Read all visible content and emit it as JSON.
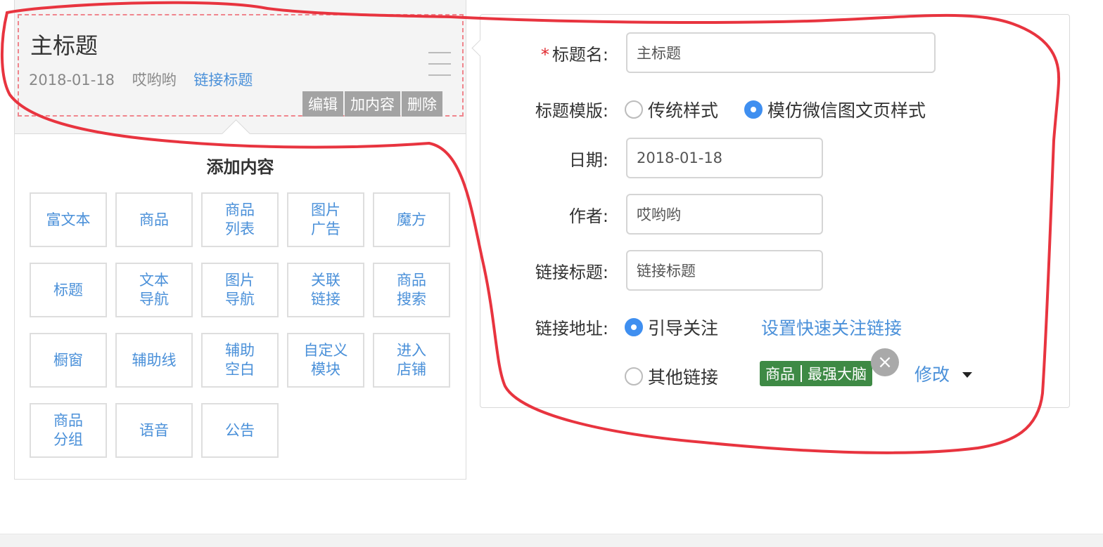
{
  "preview": {
    "title": "主标题",
    "date": "2018-01-18",
    "author": "哎哟哟",
    "link_title": "链接标题",
    "actions": [
      "编辑",
      "加内容",
      "删除"
    ]
  },
  "add_content": {
    "heading": "添加内容",
    "items": [
      "富文本",
      "商品",
      "商品\n列表",
      "图片\n广告",
      "魔方",
      "标题",
      "文本\n导航",
      "图片\n导航",
      "关联\n链接",
      "商品\n搜索",
      "橱窗",
      "辅助线",
      "辅助\n空白",
      "自定义\n模块",
      "进入\n店铺",
      "商品\n分组",
      "语音",
      "公告"
    ]
  },
  "form": {
    "required_mark": "*",
    "title_label": "标题名:",
    "title_value": "主标题",
    "template_label": "标题模版:",
    "template_options": [
      "传统样式",
      "模仿微信图文页样式"
    ],
    "template_selected": 1,
    "date_label": "日期:",
    "date_value": "2018-01-18",
    "author_label": "作者:",
    "author_value": "哎哟哟",
    "link_title_label": "链接标题:",
    "link_title_value": "链接标题",
    "link_url_label": "链接地址:",
    "follow_option": "引导关注",
    "follow_link": "设置快速关注链接",
    "other_option": "其他链接",
    "tag_type": "商品",
    "tag_name": "最强大脑",
    "tag_close": "×",
    "modify_label": "修改"
  },
  "colors": {
    "annotation": "#e8343f",
    "link": "#4a90d9",
    "tag": "#3e8a45",
    "radio_on": "#3f8ff0"
  }
}
